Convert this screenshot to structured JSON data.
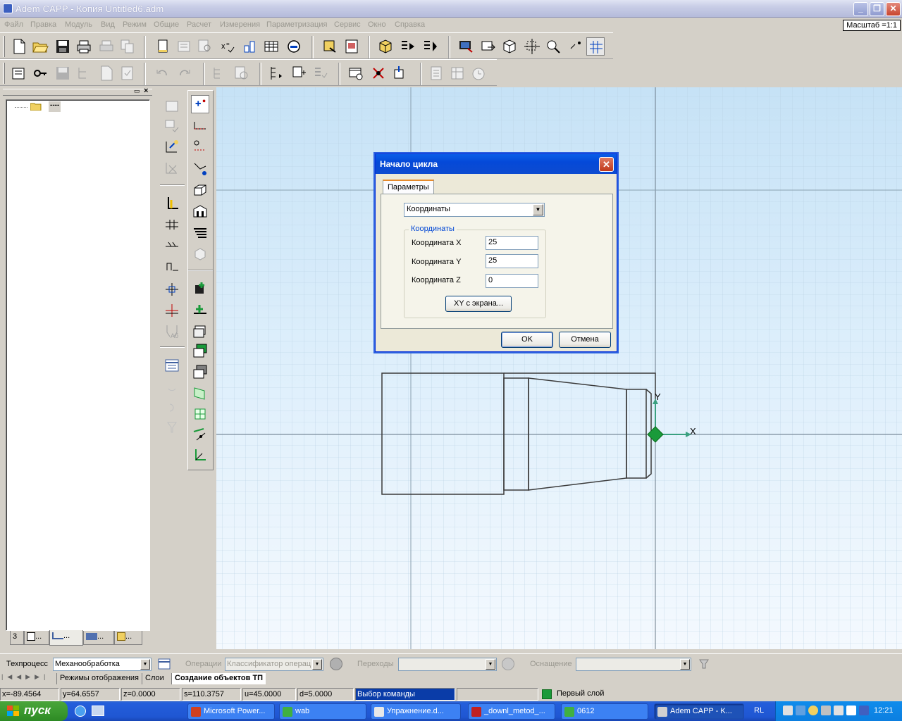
{
  "window": {
    "title": "Adem CAPP - Копия Untitled6.adm"
  },
  "menu": [
    "Файл",
    "Правка",
    "Модуль",
    "Вид",
    "Режим",
    "Общие",
    "Расчет",
    "Измерения",
    "Параметризация",
    "Сервис",
    "Окно",
    "Справка"
  ],
  "zoom_label": "Масштаб =1:1",
  "tree": {
    "root_label": "----"
  },
  "panel_tabs": [
    "3",
    "...",
    "...",
    "...",
    "..."
  ],
  "dialog": {
    "title": "Начало цикла",
    "tab": "Параметры",
    "mode": "Координаты",
    "group": "Координаты",
    "x_label": "Координата X",
    "x_value": "25",
    "y_label": "Координата Y",
    "y_value": "25",
    "z_label": "Координата Z",
    "z_value": "0",
    "screen_button": "XY с экрана...",
    "ok": "OK",
    "cancel": "Отмена"
  },
  "axes": {
    "x": "X",
    "y": "Y"
  },
  "bottombar": {
    "process_label": "Техпроцесс",
    "process_value": "Механообработка",
    "ops_label": "Операции",
    "ops_value": "Классификатор операц",
    "trans_label": "Переходы",
    "trans_value": "",
    "equip_label": "Оснащение",
    "equip_value": ""
  },
  "sheet_tabs": [
    "Режимы отображения",
    "Слои",
    "Создание объектов ТП"
  ],
  "status": {
    "x": "x=-89.4564",
    "y": "y=64.6557",
    "z": "z=0.0000",
    "s": "s=110.3757",
    "u": "u=45.0000",
    "d": "d=5.0000",
    "cmd": "Выбор команды",
    "layer": "Первый слой"
  },
  "taskbar": {
    "start": "пуск",
    "tasks": [
      "Microsoft Power...",
      "wab",
      "Упражнение.d...",
      "_downl_metod_...",
      "0612",
      "Adem CAPP - K..."
    ],
    "lang": "RL",
    "clock": "12:21"
  },
  "colors": {
    "accent": "#0549d8",
    "canvas_top": "#c6e2f6",
    "origin": "#1a9a3a"
  }
}
